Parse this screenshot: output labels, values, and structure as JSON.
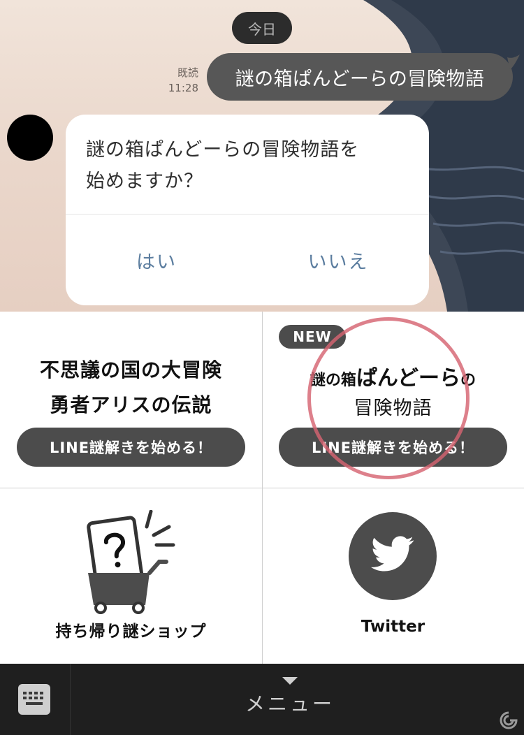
{
  "chat": {
    "date_label": "今日",
    "read_status": "既読",
    "sent_time": "11:28",
    "sent_message": "謎の箱ぱんどーらの冒険物語",
    "bot_prompt_line1": "謎の箱ぱんどーらの冒険物語を",
    "bot_prompt_line2": "始めますか？",
    "yes_label": "はい",
    "no_label": "いいえ"
  },
  "rich_menu": {
    "alice": {
      "title_line1": "不思議の国の大冒険",
      "title_line2": "勇者アリスの伝説",
      "button_label": "LINE謎解きを始める！"
    },
    "pandora": {
      "badge": "NEW",
      "title_part1": "謎の箱",
      "title_part2": "ぱんどーら",
      "title_part3": "の",
      "title_line2": "冒険物語",
      "button_label": "LINE謎解きを始める！"
    },
    "shop": {
      "label": "持ち帰り謎ショップ",
      "icon": "cart-question-icon"
    },
    "twitter": {
      "label": "Twitter",
      "icon": "twitter-bird-icon"
    }
  },
  "bottom_bar": {
    "menu_label": "メニュー",
    "keyboard_icon": "keyboard-icon",
    "toggle_icon": "triangle-down-icon"
  },
  "colors": {
    "menu_button": "#4c4c4c",
    "sent_bubble": "#575757",
    "option_text": "#5b7d9f",
    "highlight_circle": "#d66472",
    "bottom_bar": "#1f1f1f"
  }
}
